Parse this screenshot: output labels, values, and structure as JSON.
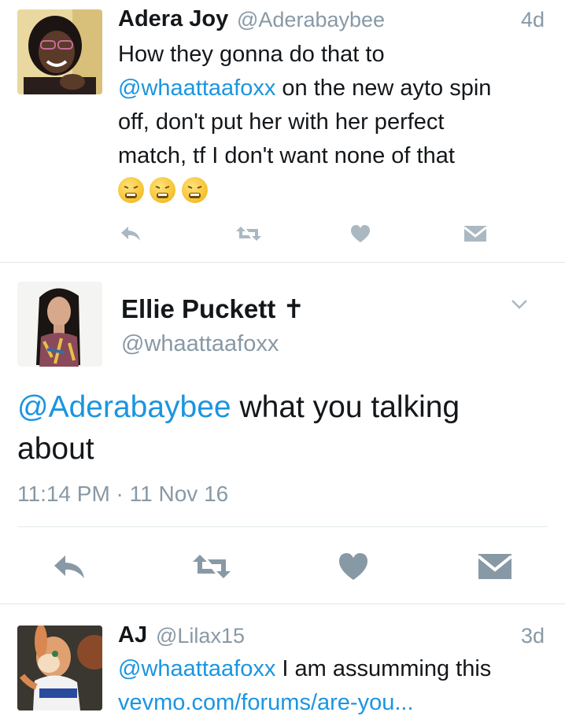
{
  "tweets": [
    {
      "name": "Adera Joy",
      "handle": "@Aderabaybee",
      "age": "4d",
      "text_line1": "How they gonna do that to",
      "mention": "@whaattaafoxx",
      "text_line2_rest": " on the new ayto spin",
      "text_line3": "off, don't put her with her perfect",
      "text_line4": "match, tf I don't want none of that",
      "emojis": [
        "weary-face",
        "weary-face",
        "weary-face"
      ]
    },
    {
      "name": "Ellie Puckett",
      "name_symbol": "✝",
      "handle": "@whaattaafoxx",
      "mention": "@Aderabaybee",
      "text_rest": " what you talking",
      "text_line2": "about",
      "timestamp": "11:14 PM · 11 Nov 16"
    },
    {
      "name": "AJ",
      "handle": "@Lilax15",
      "age": "3d",
      "mention": "@whaattaafoxx",
      "text_rest": " I am assumming this",
      "link": "vevmo.com/forums/are-you..."
    }
  ],
  "colors": {
    "link": "#1b95e0",
    "secondary": "#8899a6",
    "action_icon": "#aab8c2",
    "action_icon_large": "#8899a6"
  },
  "icons": [
    "reply-icon",
    "retweet-icon",
    "like-icon",
    "message-icon",
    "chevron-down-icon"
  ]
}
